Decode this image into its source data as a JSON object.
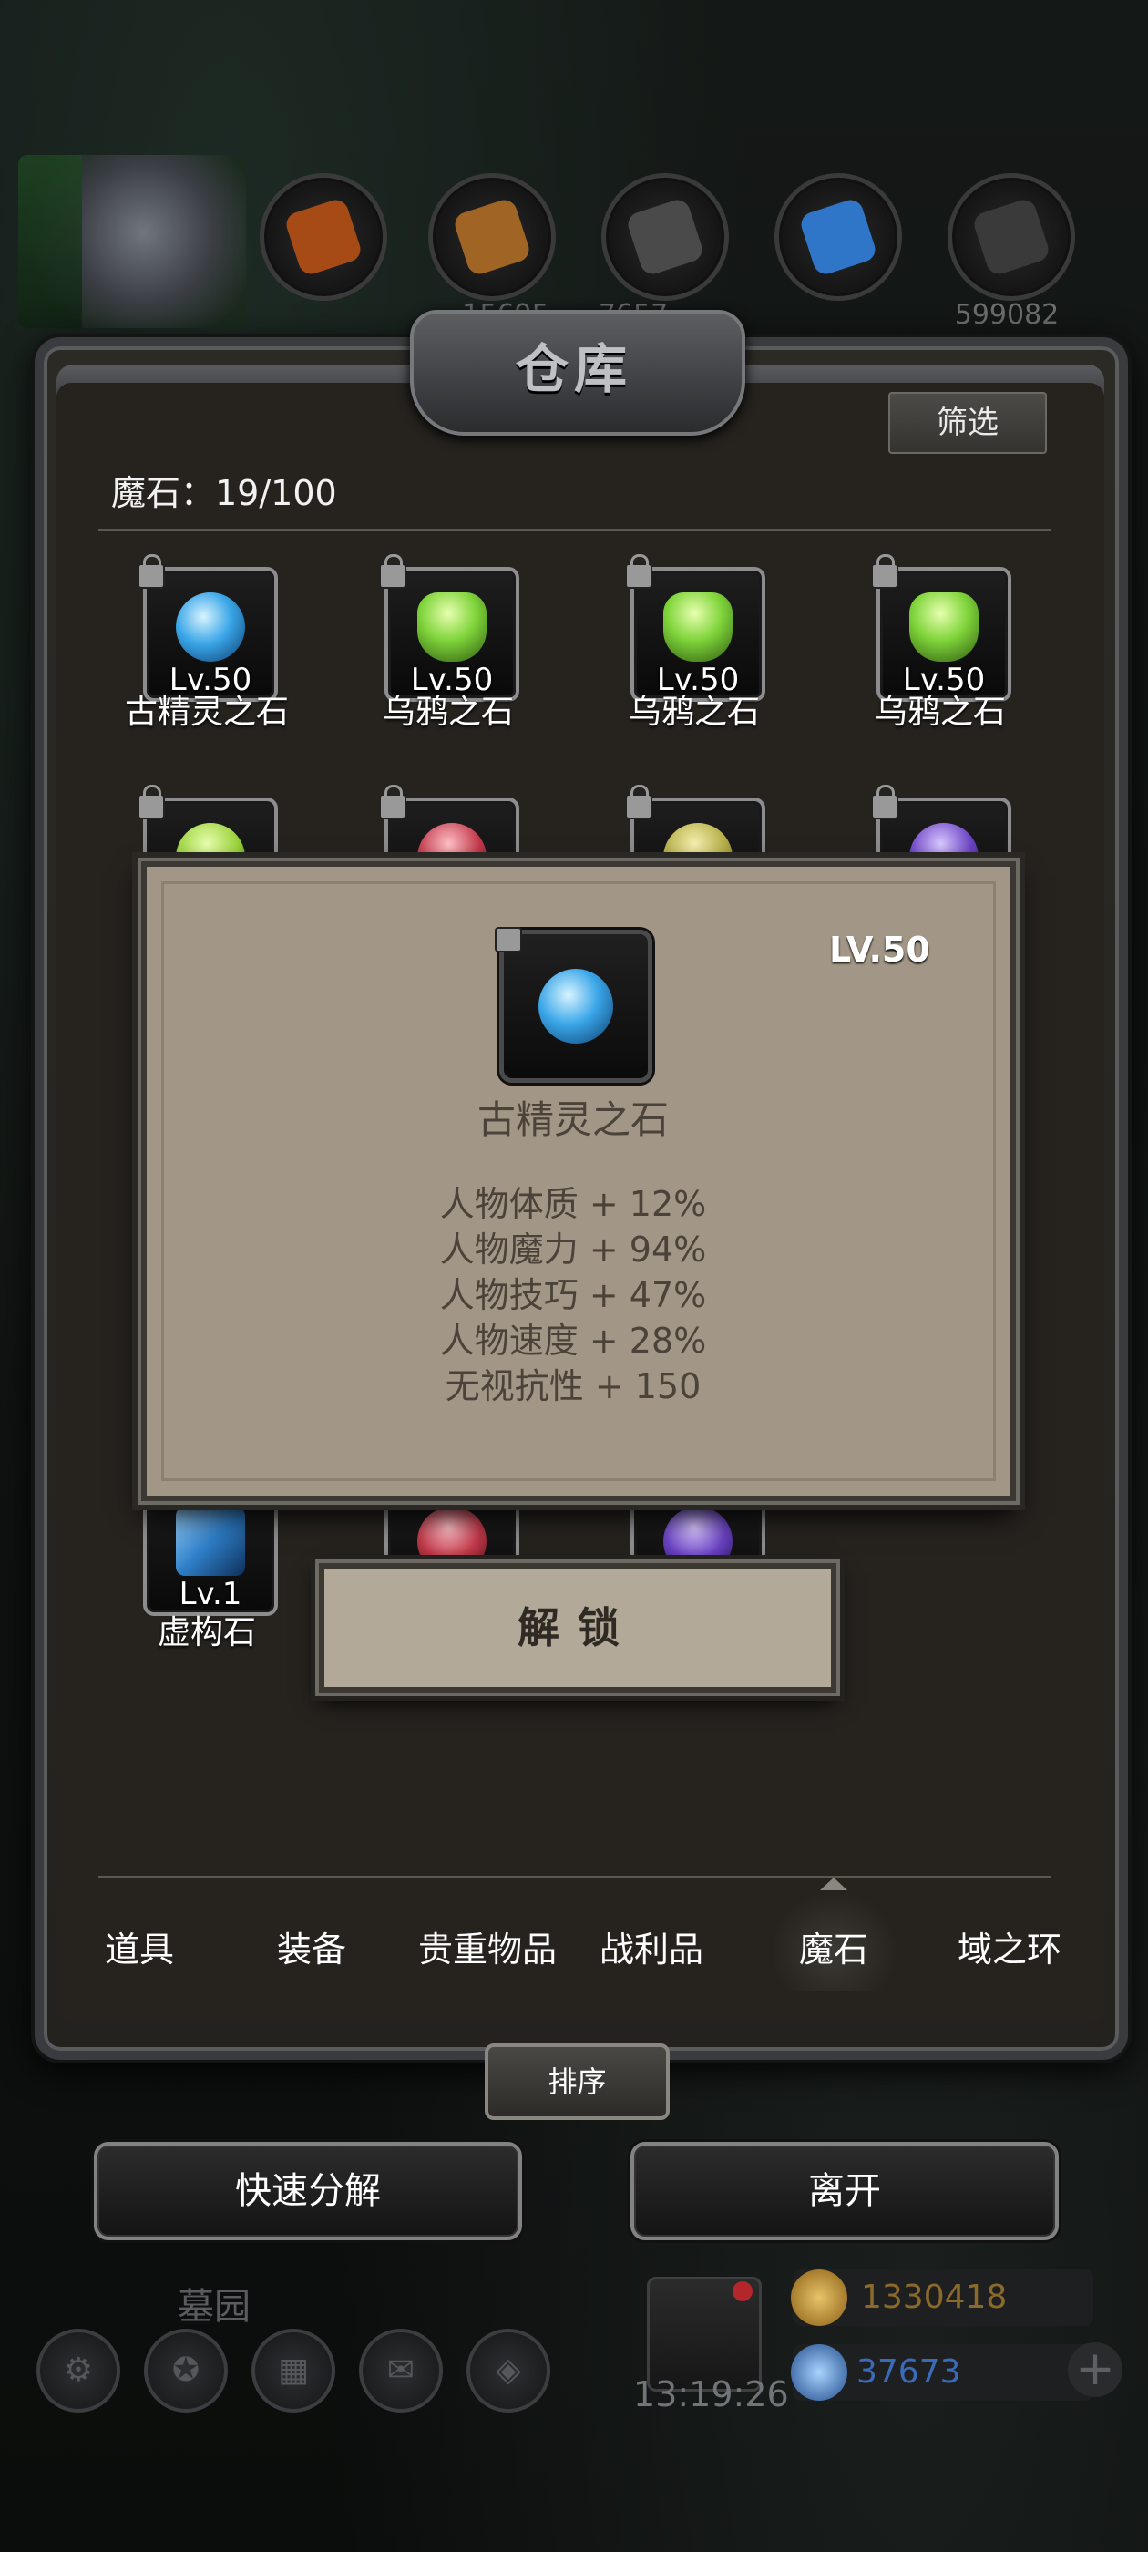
{
  "title": "仓库",
  "filter_label": "筛选",
  "count": "魔石：19/100",
  "top_resources": [
    "15695",
    "7657",
    "599082"
  ],
  "items": [
    {
      "name": "古精灵之石",
      "level": "Lv.50",
      "color": "#3aa6e8"
    },
    {
      "name": "乌鸦之石",
      "level": "Lv.50",
      "color": "#7fd43a"
    },
    {
      "name": "乌鸦之石",
      "level": "Lv.50",
      "color": "#7fd43a"
    },
    {
      "name": "乌鸦之石",
      "level": "Lv.50",
      "color": "#7fd43a"
    },
    {
      "name": "",
      "level": "",
      "color": "#9bd23a"
    },
    {
      "name": "",
      "level": "",
      "color": "#c23a4a"
    },
    {
      "name": "",
      "level": "",
      "color": "#b5ad46"
    },
    {
      "name": "",
      "level": "",
      "color": "#6b43c4"
    },
    {
      "name": "虚构石",
      "level": "Lv.1",
      "color": "#2f7fc8"
    },
    {
      "name": "",
      "level": "",
      "color": "#c23a4a"
    },
    {
      "name": "",
      "level": "",
      "color": "#6b43c4"
    }
  ],
  "tooltip": {
    "level": "LV.50",
    "name": "古精灵之石",
    "stats": [
      "人物体质 + 12%",
      "人物魔力 + 94%",
      "人物技巧 + 47%",
      "人物速度 + 28%",
      "无视抗性 + 150"
    ]
  },
  "unlock_label": "解锁",
  "tabs": [
    "道具",
    "装备",
    "贵重物品",
    "战利品",
    "魔石",
    "域之环"
  ],
  "active_tab": "魔石",
  "sort_label": "排序",
  "quick_decompose_label": "快速分解",
  "leave_label": "离开",
  "location": "墓园",
  "clock": "13:19:26",
  "gold": "1330418",
  "gems": "37673",
  "colors": {
    "accent_gold": "#c79a2e",
    "accent_blue": "#3a7ad8",
    "tooltip_bg": "#a29786"
  }
}
